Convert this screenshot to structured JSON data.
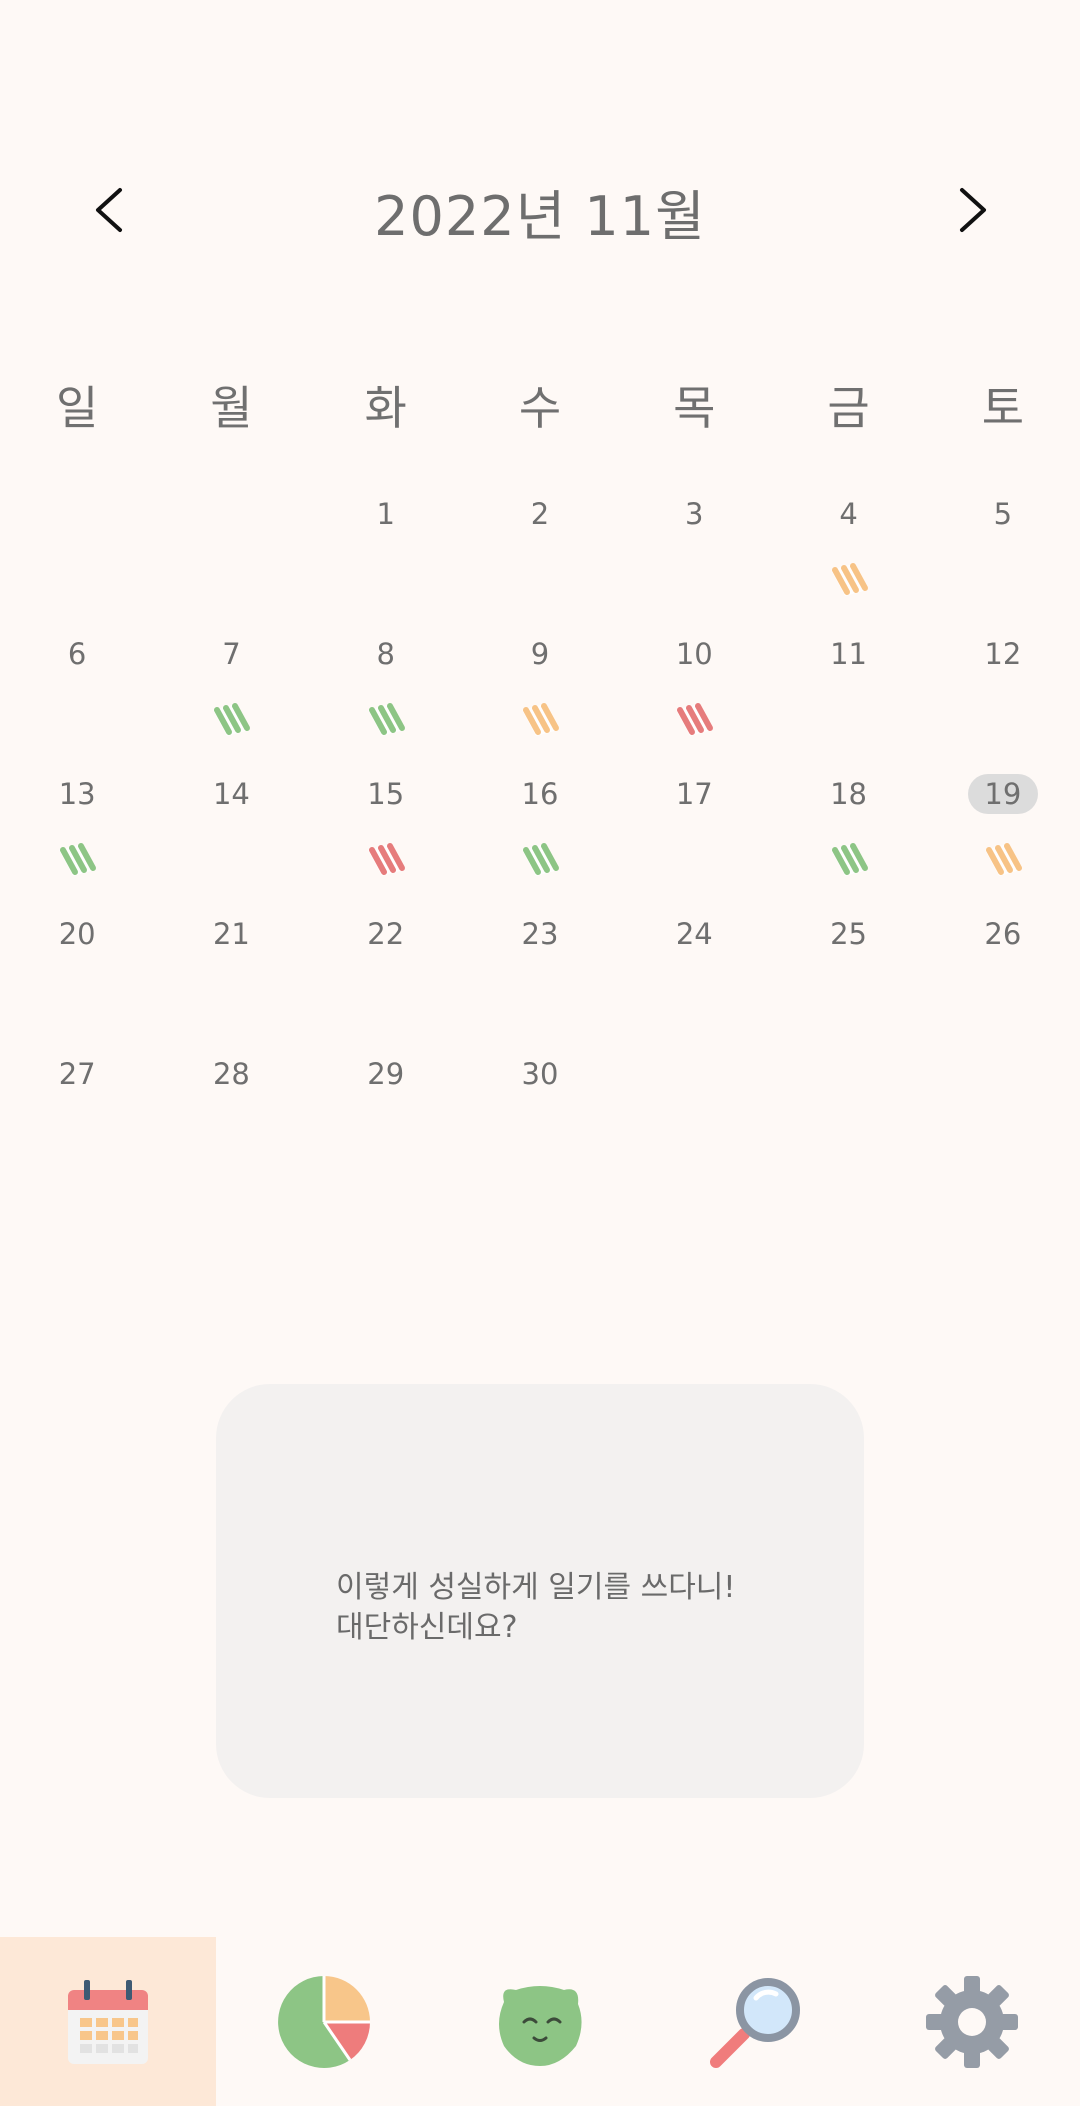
{
  "header": {
    "title": "2022년 11월",
    "prev_icon": "chevron-left-icon",
    "next_icon": "chevron-right-icon"
  },
  "weekdays": [
    "일",
    "월",
    "화",
    "수",
    "목",
    "금",
    "토"
  ],
  "calendar": {
    "weeks": [
      [
        {
          "day": ""
        },
        {
          "day": ""
        },
        {
          "day": "1"
        },
        {
          "day": "2"
        },
        {
          "day": "3"
        },
        {
          "day": "4",
          "mood": "orange"
        },
        {
          "day": "5"
        }
      ],
      [
        {
          "day": "6"
        },
        {
          "day": "7",
          "mood": "green"
        },
        {
          "day": "8",
          "mood": "green"
        },
        {
          "day": "9",
          "mood": "orange"
        },
        {
          "day": "10",
          "mood": "red"
        },
        {
          "day": "11"
        },
        {
          "day": "12"
        }
      ],
      [
        {
          "day": "13",
          "mood": "green"
        },
        {
          "day": "14"
        },
        {
          "day": "15",
          "mood": "red"
        },
        {
          "day": "16",
          "mood": "green"
        },
        {
          "day": "17"
        },
        {
          "day": "18",
          "mood": "green"
        },
        {
          "day": "19",
          "mood": "orange",
          "today": true
        }
      ],
      [
        {
          "day": "20"
        },
        {
          "day": "21"
        },
        {
          "day": "22"
        },
        {
          "day": "23"
        },
        {
          "day": "24"
        },
        {
          "day": "25"
        },
        {
          "day": "26"
        }
      ],
      [
        {
          "day": "27"
        },
        {
          "day": "28"
        },
        {
          "day": "29"
        },
        {
          "day": "30"
        },
        {
          "day": ""
        },
        {
          "day": ""
        },
        {
          "day": ""
        }
      ]
    ],
    "mood_colors": {
      "green": "#8DC585",
      "orange": "#F7C386",
      "red": "#E67C7C"
    }
  },
  "message": {
    "line1": "이렇게 성실하게 일기를 쓰다니!",
    "line2": "대단하신데요?"
  },
  "tabbar": {
    "items": [
      {
        "icon": "calendar-icon",
        "active": true
      },
      {
        "icon": "pie-chart-icon",
        "active": false
      },
      {
        "icon": "cat-face-icon",
        "active": false
      },
      {
        "icon": "search-icon",
        "active": false
      },
      {
        "icon": "gear-icon",
        "active": false
      }
    ]
  },
  "colors": {
    "background": "#FEF9F6",
    "active_tab": "#FDE8D7",
    "card": "#F3F1F0",
    "today_highlight": "#DCDCDC"
  }
}
